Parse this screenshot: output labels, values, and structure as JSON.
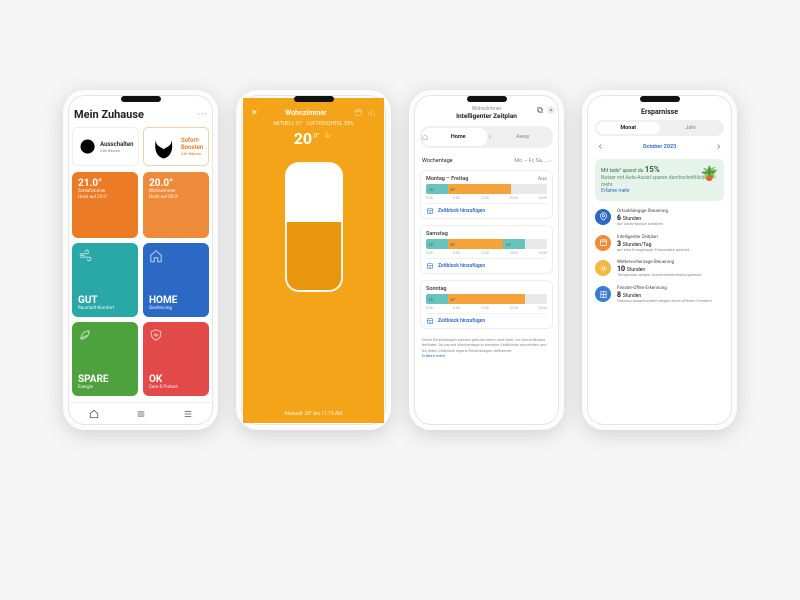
{
  "phone1": {
    "title": "Mein Zuhause",
    "pill_off": {
      "title": "Ausschalten",
      "sub": "Alle Räume"
    },
    "pill_boost": {
      "title": "Sofort-Boosten",
      "sub": "Alle Räume"
    },
    "tiles": [
      {
        "value": "21.0°",
        "name": "Schlafzimmer",
        "sub": "Heizt auf 23.0°"
      },
      {
        "value": "20.0°",
        "name": "Wohnzimmer",
        "sub": "Heizt auf 20.0°"
      },
      {
        "value": "GUT",
        "name": "Raumluft-Komfort",
        "sub": ""
      },
      {
        "value": "HOME",
        "name": "Geofencing",
        "sub": ""
      },
      {
        "value": "SPARE",
        "name": "Energie",
        "sub": ""
      },
      {
        "value": "OK",
        "name": "Care & Protect",
        "sub": ""
      }
    ]
  },
  "phone2": {
    "room": "Wohnzimmer",
    "stats_left": "AKTUELL 21°",
    "stats_right": "LUFTFEUCHTIG. 55%",
    "temp_int": "20",
    "temp_dec": ".0",
    "temp_unit": "°",
    "hand": "✋",
    "footer": "Manuell: 20° bis 11:15 AM"
  },
  "phone3": {
    "sub": "Wohnzimmer",
    "title": "Intelligenter Zeitplan",
    "home": "Home",
    "away": "Away",
    "wd_label": "Wochentage",
    "wd_value": "Mo – Fr, Sa, …",
    "add": "Zeitblock hinzufügen",
    "note": "Diese Einstellungen werden genutzt wenn sich tado° im Home-Modus befindet. Du kannst Wochentage in einzelne Zeitblöcke unterteilen und für jeden Zeitblock eigene Einstellungen definieren.",
    "more": "Erfahre mehr",
    "days": [
      {
        "name": "Montag – Freitag",
        "right": "Aus",
        "blocks": [
          {
            "cls": "seg-teal",
            "w": 18,
            "t": "15°"
          },
          {
            "cls": "seg-or",
            "w": 52,
            "t": "20°"
          },
          {
            "cls": "seg-gr",
            "w": 30,
            "t": ""
          }
        ]
      },
      {
        "name": "Samstag",
        "right": "",
        "blocks": [
          {
            "cls": "seg-teal",
            "w": 18,
            "t": "15°"
          },
          {
            "cls": "seg-or",
            "w": 46,
            "t": "20°"
          },
          {
            "cls": "seg-teal",
            "w": 18,
            "t": "15°"
          },
          {
            "cls": "seg-gr",
            "w": 18,
            "t": ""
          }
        ]
      },
      {
        "name": "Sonntag",
        "right": "",
        "blocks": [
          {
            "cls": "seg-teal",
            "w": 18,
            "t": "15°"
          },
          {
            "cls": "seg-or",
            "w": 64,
            "t": "20°"
          },
          {
            "cls": "seg-gr",
            "w": 18,
            "t": ""
          }
        ]
      }
    ],
    "ticks": [
      "0:00",
      "6:00",
      "12:00",
      "18:00",
      "24:00"
    ]
  },
  "phone4": {
    "title": "Ersparnisse",
    "seg_month": "Monat",
    "seg_year": "Jahr",
    "month": "October 2023",
    "save_line": "Mit tado° sparst du",
    "save_pct": "15%",
    "save_sub": "Nutzer mit Auto-Assist sparen durchschnittlich mehr.",
    "save_more": "Erfahre mehr",
    "stats": [
      {
        "icon": "geo",
        "label": "Ortsabhängige Steuerung",
        "num": "6",
        "unit": "Stunden",
        "sub": "auf Away-Modus schalten"
      },
      {
        "icon": "sched",
        "label": "Intelligenter Zeitplan",
        "num": "3",
        "unit": "Stunden/Tag",
        "sub": "auf eine Energiespar-Temperatur gesetzt"
      },
      {
        "icon": "sun",
        "label": "Wettervorhersage-Steuerung",
        "num": "10",
        "unit": "Stunden",
        "sub": "Temperatur wegen Sonneneinstrahlung gesenkt"
      },
      {
        "icon": "win",
        "label": "Fenster-Offen-Erkennung",
        "num": "8",
        "unit": "Stunden",
        "sub": "Heizung ausgeschaltet wegen eines offenen Fensters"
      }
    ]
  }
}
